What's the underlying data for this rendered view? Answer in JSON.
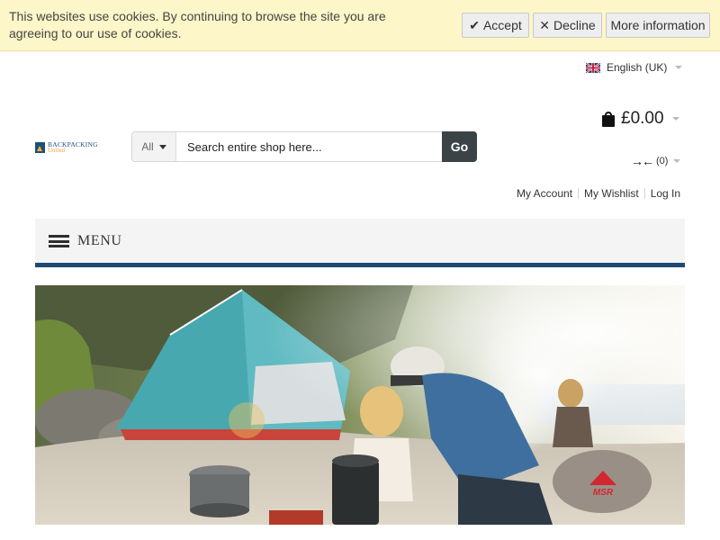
{
  "cookie_bar": {
    "message": "This websites use cookies. By continuing to browse the site you are agreeing to our use of cookies.",
    "accept_label": "Accept",
    "decline_label": "Decline",
    "more_label": "More information"
  },
  "language": {
    "label": "English (UK)",
    "flag_icon": "uk-flag-icon"
  },
  "logo": {
    "line1": "BACKPACKING",
    "line2": "United"
  },
  "search": {
    "category": "All",
    "placeholder": "Search entire shop here...",
    "go_label": "Go"
  },
  "cart": {
    "total": "£0.00"
  },
  "compare": {
    "count": "(0)"
  },
  "account_links": {
    "my_account": "My Account",
    "my_wishlist": "My Wishlist",
    "log_in": "Log In"
  },
  "menu": {
    "label": "MENU"
  },
  "hero": {
    "brand": "MSR",
    "brand_color": "#d22630"
  },
  "colors": {
    "accent": "#1b4a73",
    "cookie_bg": "#fdf6c8",
    "go_button": "#3c4347"
  }
}
